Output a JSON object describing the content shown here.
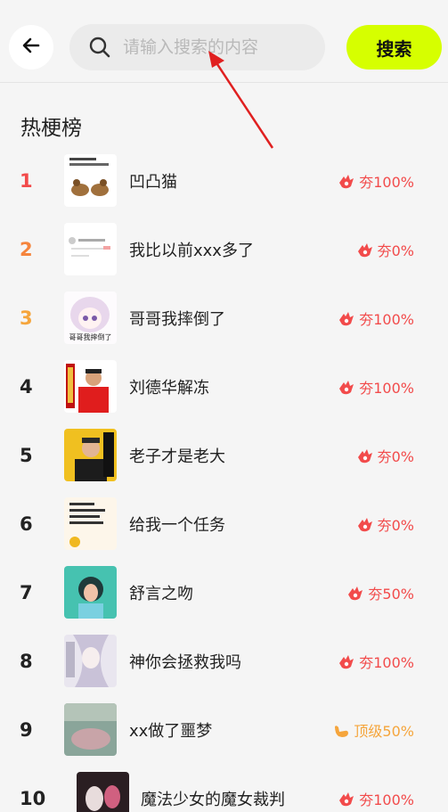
{
  "search": {
    "placeholder": "请输入搜索的内容",
    "button_label": "搜索"
  },
  "section_title": "热梗榜",
  "colors": {
    "accent": "#d6ff00",
    "rank1": "#f24b4b",
    "rank2": "#f5843c",
    "rank3": "#f5a53c",
    "heat_red": "#f24b4b",
    "heat_orange": "#f5a53c"
  },
  "items": [
    {
      "rank": "1",
      "title": "凹凸猫",
      "heat": "夯100%",
      "heat_icon": "fire-hand-icon",
      "thumb_icon": "cat-meme-thumb",
      "rank_color": "#f24b4b",
      "heat_color": "#f24b4b"
    },
    {
      "rank": "2",
      "title": "我比以前xxx多了",
      "heat": "夯0%",
      "heat_icon": "fire-hand-icon",
      "thumb_icon": "text-post-thumb",
      "rank_color": "#f5843c",
      "heat_color": "#f24b4b"
    },
    {
      "rank": "3",
      "title": "哥哥我摔倒了",
      "heat": "夯100%",
      "heat_icon": "fire-hand-icon",
      "thumb_icon": "anime-girl-thumb",
      "thumb_caption": "哥哥我摔倒了",
      "rank_color": "#f5a53c",
      "heat_color": "#f24b4b"
    },
    {
      "rank": "4",
      "title": "刘德华解冻",
      "heat": "夯100%",
      "heat_icon": "fire-hand-icon",
      "thumb_icon": "man-red-thumb",
      "rank_color": "#222222",
      "heat_color": "#f24b4b"
    },
    {
      "rank": "5",
      "title": "老子才是老大",
      "heat": "夯0%",
      "heat_icon": "fire-hand-icon",
      "thumb_icon": "man-black-thumb",
      "rank_color": "#222222",
      "heat_color": "#f24b4b"
    },
    {
      "rank": "6",
      "title": "给我一个任务",
      "heat": "夯0%",
      "heat_icon": "fire-hand-icon",
      "thumb_icon": "text-card-thumb",
      "rank_color": "#222222",
      "heat_color": "#f24b4b"
    },
    {
      "rank": "7",
      "title": "舒言之吻",
      "heat": "夯50%",
      "heat_icon": "fire-hand-icon",
      "thumb_icon": "3d-girl-thumb",
      "rank_color": "#222222",
      "heat_color": "#f24b4b"
    },
    {
      "rank": "8",
      "title": "神你会拯救我吗",
      "heat": "夯100%",
      "heat_icon": "fire-hand-icon",
      "thumb_icon": "anime-silver-thumb",
      "rank_color": "#222222",
      "heat_color": "#f24b4b"
    },
    {
      "rank": "9",
      "title": "xx做了噩梦",
      "heat": "顶级50%",
      "heat_icon": "shaka-hand-icon",
      "thumb_icon": "blurry-photo-thumb",
      "rank_color": "#222222",
      "heat_color": "#f5a53c"
    },
    {
      "rank": "10",
      "title": "魔法少女的魔女裁判",
      "heat": "夯100%",
      "heat_icon": "fire-hand-icon",
      "thumb_icon": "dark-anime-thumb",
      "rank_color": "#222222",
      "heat_color": "#f24b4b"
    }
  ]
}
